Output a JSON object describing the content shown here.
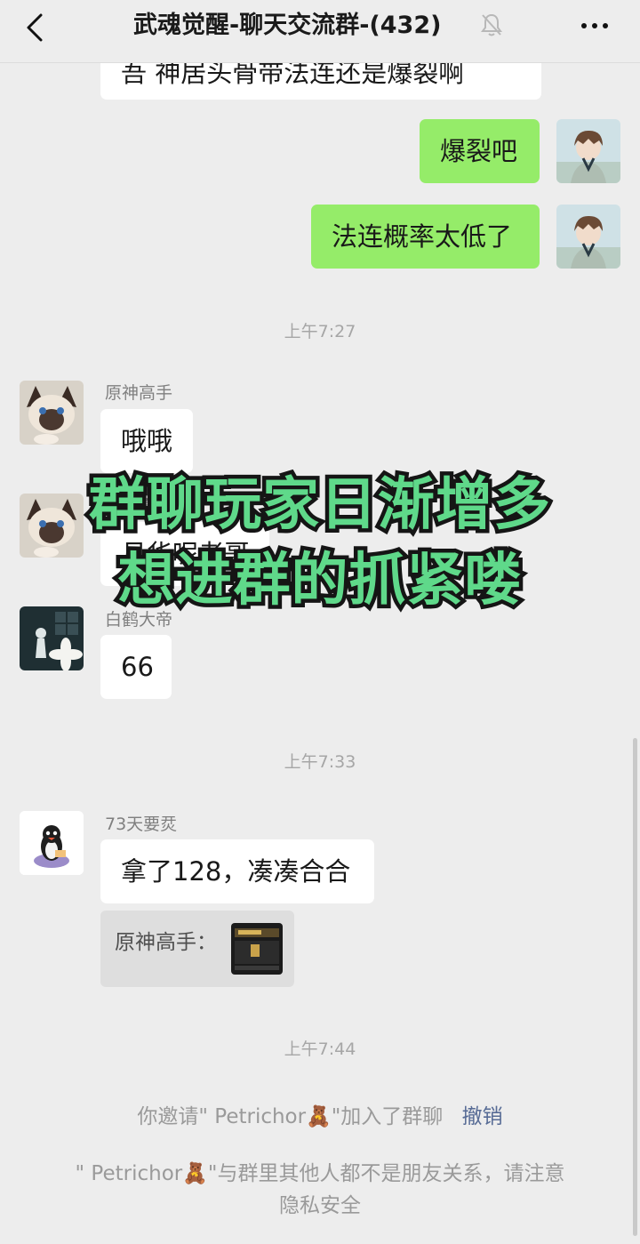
{
  "header": {
    "title": "武魂觉醒-聊天交流群-(432)",
    "icons": [
      "chevron-left-icon",
      "bell-off-icon",
      "more-dots-icon"
    ]
  },
  "messages": {
    "partial_top": "吾 神居头骨带法连还是爆裂啊",
    "out1": "爆裂吧",
    "out2": "法连概率太低了",
    "time1": "上午7:27",
    "m1_sender": "原神高手",
    "m1_text": "哦哦",
    "m2_sender": "原神高手",
    "m2_text": "月华呢老哥",
    "m3_sender": "白鹤大帝",
    "m3_text": "66",
    "time2": "上午7:33",
    "m4_sender": "73天要烎",
    "m4_text": "拿了128，凑凑合合",
    "quote_label": "原神高手：",
    "time3": "上午7:44"
  },
  "system": {
    "invite_prefix": "你邀请\" Petrichor🧸\"加入了群聊",
    "invite_action": "撤销",
    "warning_line1": "\" Petrichor🧸\"与群里其他人都不是朋友关系，请注意",
    "warning_line2": "隐私安全"
  },
  "overlay": {
    "line1": "群聊玩家日渐增多",
    "line2": "想进群的抓紧喽"
  },
  "colors": {
    "background": "#ededed",
    "outgoing_bubble": "#95ec69",
    "incoming_bubble": "#ffffff",
    "link": "#576b95",
    "overlay_fill": "#5fd98a",
    "overlay_stroke": "#151515"
  }
}
